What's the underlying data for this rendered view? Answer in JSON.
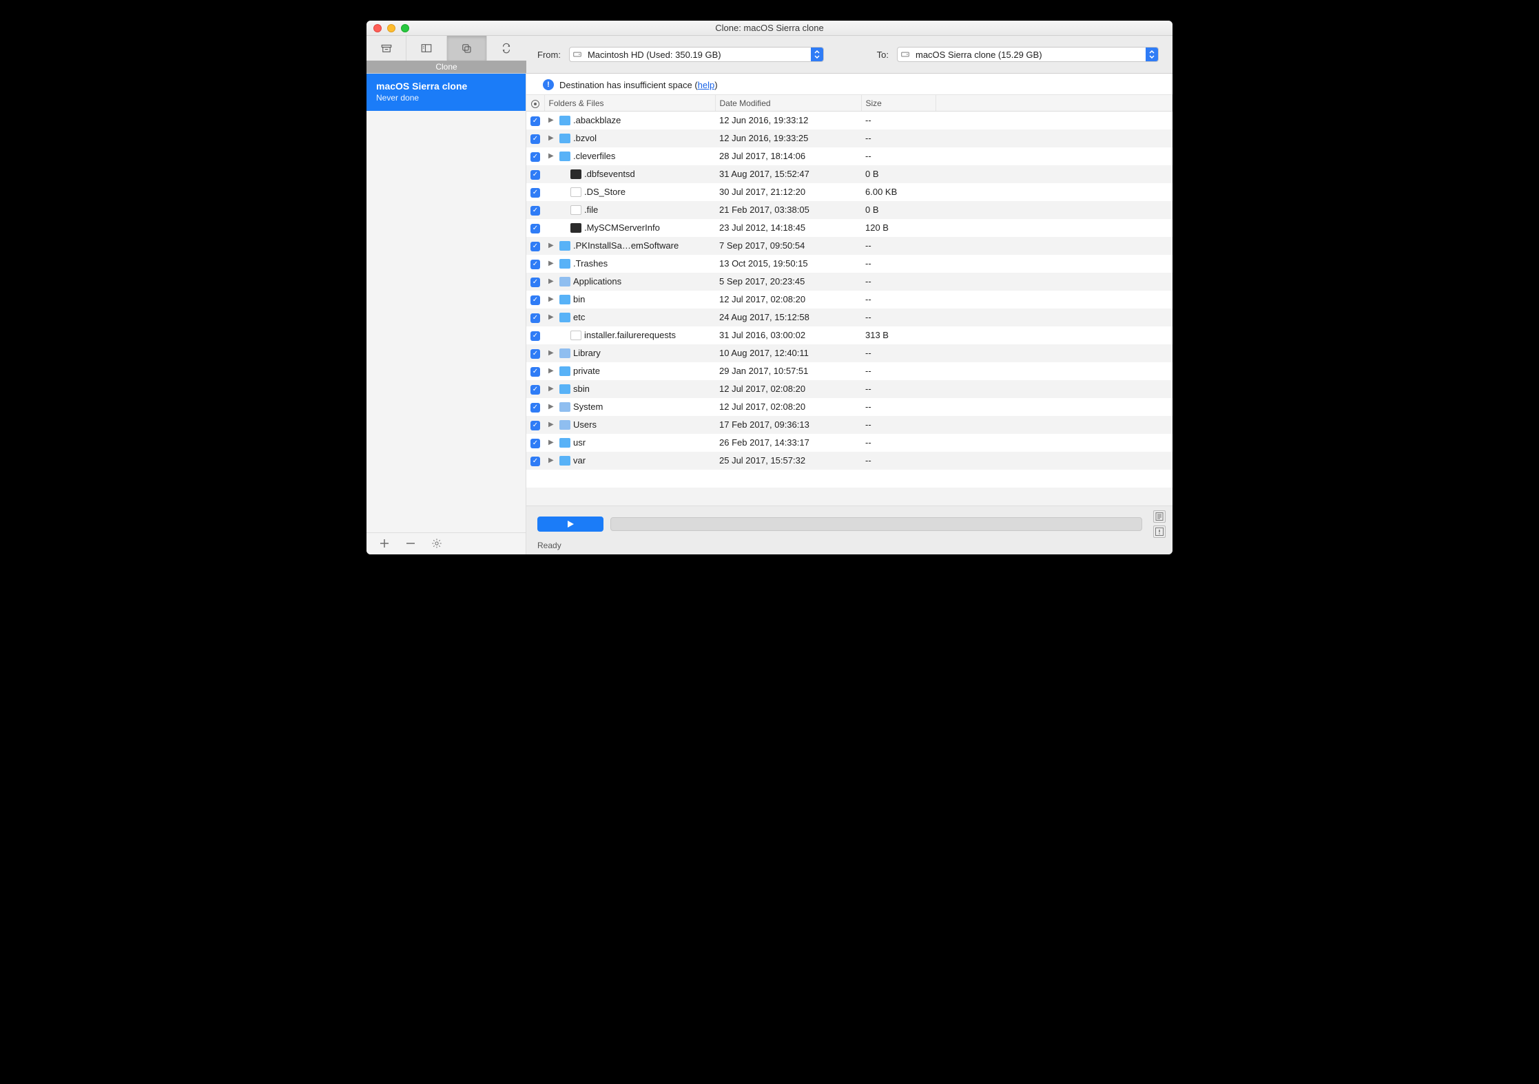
{
  "window": {
    "title": "Clone: macOS Sierra clone"
  },
  "sidebar": {
    "section_label": "Clone",
    "task": {
      "title": "macOS Sierra clone",
      "subtitle": "Never done"
    },
    "footer": {
      "add_label": "+",
      "remove_label": "−"
    }
  },
  "toolbar": {
    "from_label": "From:",
    "from_value": "Macintosh HD (Used: 350.19 GB)",
    "to_label": "To:",
    "to_value": "macOS Sierra clone (15.29 GB)"
  },
  "warning": {
    "text_before": "Destination has insufficient space (",
    "link_text": "help",
    "text_after": ")"
  },
  "table": {
    "headers": {
      "name": "Folders & Files",
      "date": "Date Modified",
      "size": "Size"
    },
    "rows": [
      {
        "name": ".abackblaze",
        "date": "12 Jun 2016, 19:33:12",
        "size": "--",
        "type": "folder",
        "expandable": true
      },
      {
        "name": ".bzvol",
        "date": "12 Jun 2016, 19:33:25",
        "size": "--",
        "type": "folder",
        "expandable": true
      },
      {
        "name": ".cleverfiles",
        "date": "28 Jul 2017, 18:14:06",
        "size": "--",
        "type": "folder",
        "expandable": true
      },
      {
        "name": ".dbfseventsd",
        "date": "31 Aug 2017, 15:52:47",
        "size": "0 B",
        "type": "exec",
        "expandable": false
      },
      {
        "name": ".DS_Store",
        "date": "30 Jul 2017, 21:12:20",
        "size": "6.00 KB",
        "type": "file",
        "expandable": false
      },
      {
        "name": ".file",
        "date": "21 Feb 2017, 03:38:05",
        "size": "0 B",
        "type": "file",
        "expandable": false
      },
      {
        "name": ".MySCMServerInfo",
        "date": "23 Jul 2012, 14:18:45",
        "size": "120 B",
        "type": "exec",
        "expandable": false
      },
      {
        "name": ".PKInstallSa…emSoftware",
        "date": "7 Sep 2017, 09:50:54",
        "size": "--",
        "type": "folder",
        "expandable": true
      },
      {
        "name": ".Trashes",
        "date": "13 Oct 2015, 19:50:15",
        "size": "--",
        "type": "folder",
        "expandable": true
      },
      {
        "name": "Applications",
        "date": "5 Sep 2017, 20:23:45",
        "size": "--",
        "type": "sysfolder",
        "expandable": true
      },
      {
        "name": "bin",
        "date": "12 Jul 2017, 02:08:20",
        "size": "--",
        "type": "folder",
        "expandable": true
      },
      {
        "name": "etc",
        "date": "24 Aug 2017, 15:12:58",
        "size": "--",
        "type": "folder",
        "expandable": true
      },
      {
        "name": "installer.failurerequests",
        "date": "31 Jul 2016, 03:00:02",
        "size": "313 B",
        "type": "file",
        "expandable": false
      },
      {
        "name": "Library",
        "date": "10 Aug 2017, 12:40:11",
        "size": "--",
        "type": "sysfolder",
        "expandable": true
      },
      {
        "name": "private",
        "date": "29 Jan 2017, 10:57:51",
        "size": "--",
        "type": "folder",
        "expandable": true
      },
      {
        "name": "sbin",
        "date": "12 Jul 2017, 02:08:20",
        "size": "--",
        "type": "folder",
        "expandable": true
      },
      {
        "name": "System",
        "date": "12 Jul 2017, 02:08:20",
        "size": "--",
        "type": "sysfolder",
        "expandable": true
      },
      {
        "name": "Users",
        "date": "17 Feb 2017, 09:36:13",
        "size": "--",
        "type": "sysfolder",
        "expandable": true
      },
      {
        "name": "usr",
        "date": "26 Feb 2017, 14:33:17",
        "size": "--",
        "type": "folder",
        "expandable": true
      },
      {
        "name": "var",
        "date": "25 Jul 2017, 15:57:32",
        "size": "--",
        "type": "folder",
        "expandable": true
      }
    ]
  },
  "status": {
    "text": "Ready"
  }
}
